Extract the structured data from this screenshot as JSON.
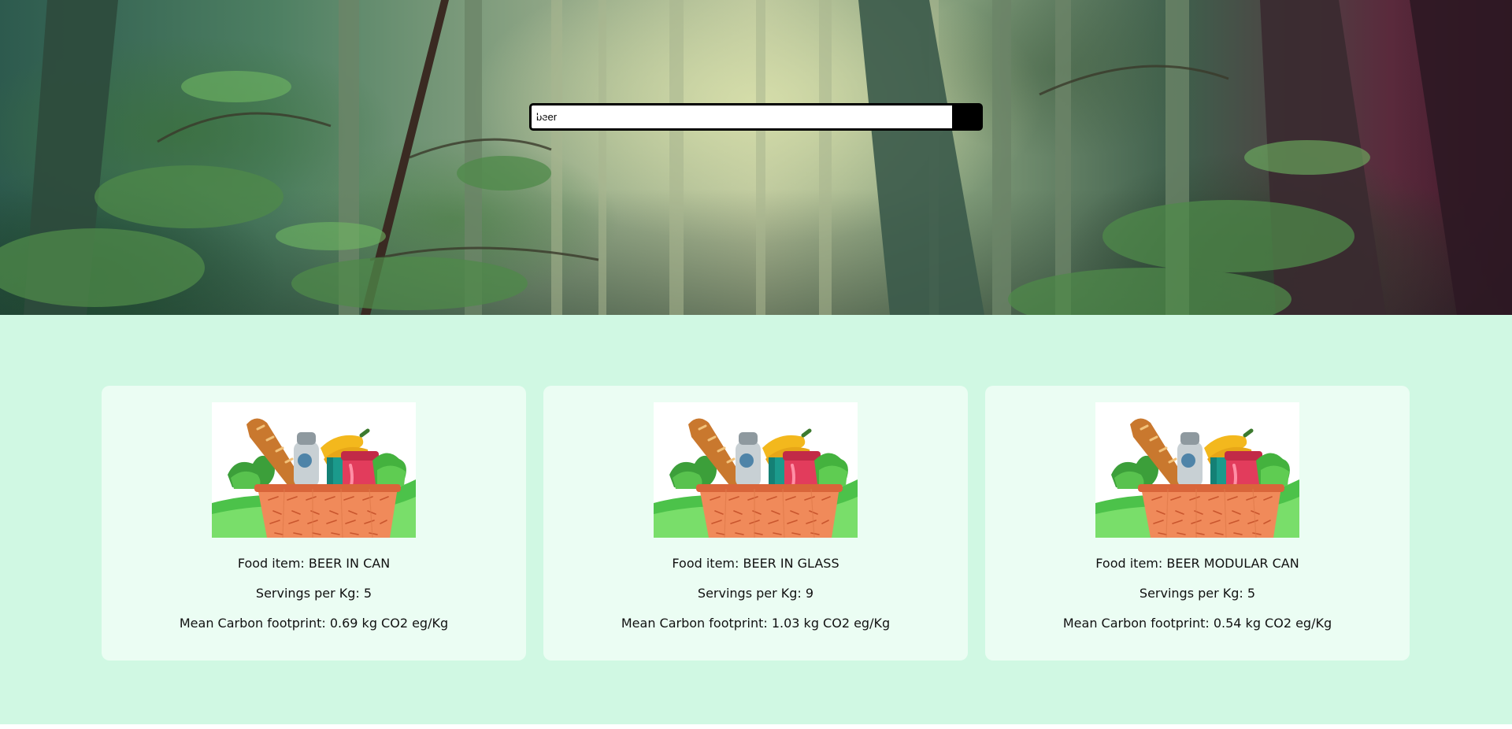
{
  "search": {
    "value": "beer",
    "placeholder": ""
  },
  "icons": {
    "search_button": "search-icon",
    "card_image": "grocery-basket-icon"
  },
  "colors": {
    "page_background": "#d0f8e3",
    "card_background": "#ebfdf3",
    "search_border": "#000000"
  },
  "results": [
    {
      "food_item": "Food item: BEER IN CAN",
      "servings": "Servings per Kg: 5",
      "carbon": "Mean Carbon footprint: 0.69 kg CO2 eg/Kg"
    },
    {
      "food_item": "Food item: BEER IN GLASS",
      "servings": "Servings per Kg: 9",
      "carbon": "Mean Carbon footprint: 1.03 kg CO2 eg/Kg"
    },
    {
      "food_item": "Food item: BEER MODULAR CAN",
      "servings": "Servings per Kg: 5",
      "carbon": "Mean Carbon footprint: 0.54 kg CO2 eg/Kg"
    }
  ]
}
